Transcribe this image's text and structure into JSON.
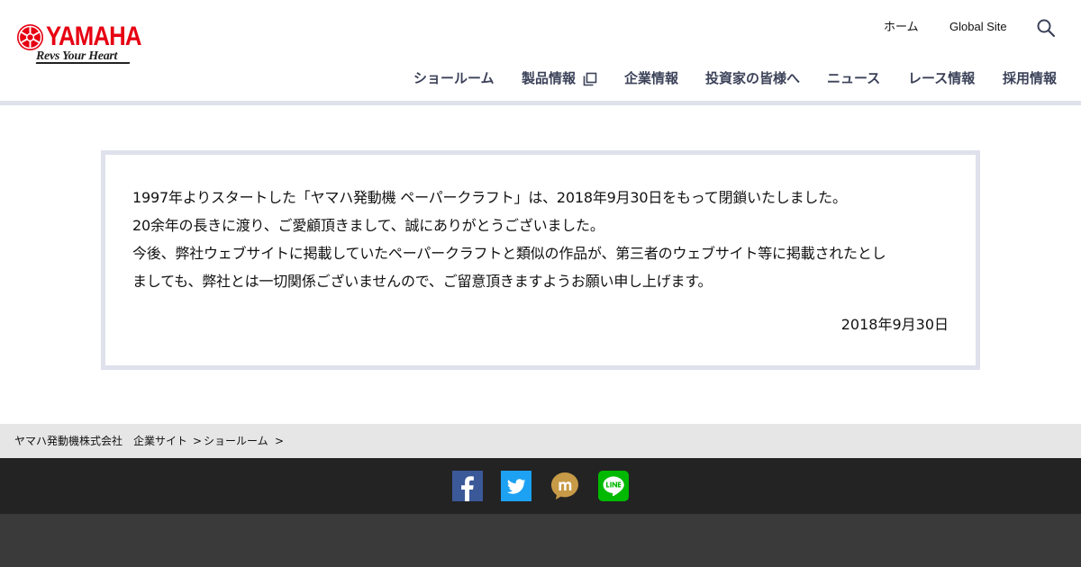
{
  "header": {
    "logo": {
      "brand": "YAMAHA",
      "tagline": "Revs Your Heart",
      "brand_color": "#e60012"
    },
    "utility_nav": [
      {
        "id": "home",
        "label": "ホーム"
      },
      {
        "id": "global",
        "label": "Global Site"
      }
    ],
    "search_icon": "search-icon",
    "main_nav": [
      {
        "id": "showroom",
        "label": "ショールーム"
      },
      {
        "id": "products",
        "label": "製品情報",
        "icon": "external-link-icon"
      },
      {
        "id": "corporate",
        "label": "企業情報"
      },
      {
        "id": "investors",
        "label": "投資家の皆様へ"
      },
      {
        "id": "news",
        "label": "ニュース"
      },
      {
        "id": "race",
        "label": "レース情報"
      },
      {
        "id": "recruit",
        "label": "採用情報"
      }
    ],
    "nav_color": "#3c4259"
  },
  "notice": {
    "lines": [
      "1997年よりスタートした「ヤマハ発動機 ペーパークラフト」は、2018年9月30日をもって閉鎖いたしました。",
      "20余年の長きに渡り、ご愛顧頂きまして、誠にありがとうございました。",
      "今後、弊社ウェブサイトに掲載していたペーパークラフトと類似の作品が、第三者のウェブサイト等に掲載されたとし",
      "ましても、弊社とは一切関係ございませんので、ご留意頂きますようお願い申し上げます。"
    ],
    "date": "2018年9月30日",
    "border_color": "#dfe1ec"
  },
  "breadcrumb": {
    "items": [
      {
        "id": "company",
        "label": "ヤマハ発動機株式会社　企業サイト"
      },
      {
        "id": "sep1",
        "label": ">"
      },
      {
        "id": "showroom",
        "label": "ショールーム"
      },
      {
        "id": "sep2",
        "label": ">"
      }
    ]
  },
  "social": [
    {
      "id": "facebook",
      "icon": "facebook-icon",
      "color": "#3b5998"
    },
    {
      "id": "twitter",
      "icon": "twitter-icon",
      "color": "#1da1f2"
    },
    {
      "id": "mixi",
      "icon": "mixi-icon",
      "color": "#c79a47"
    },
    {
      "id": "line",
      "icon": "line-icon",
      "color": "#00b900"
    }
  ]
}
